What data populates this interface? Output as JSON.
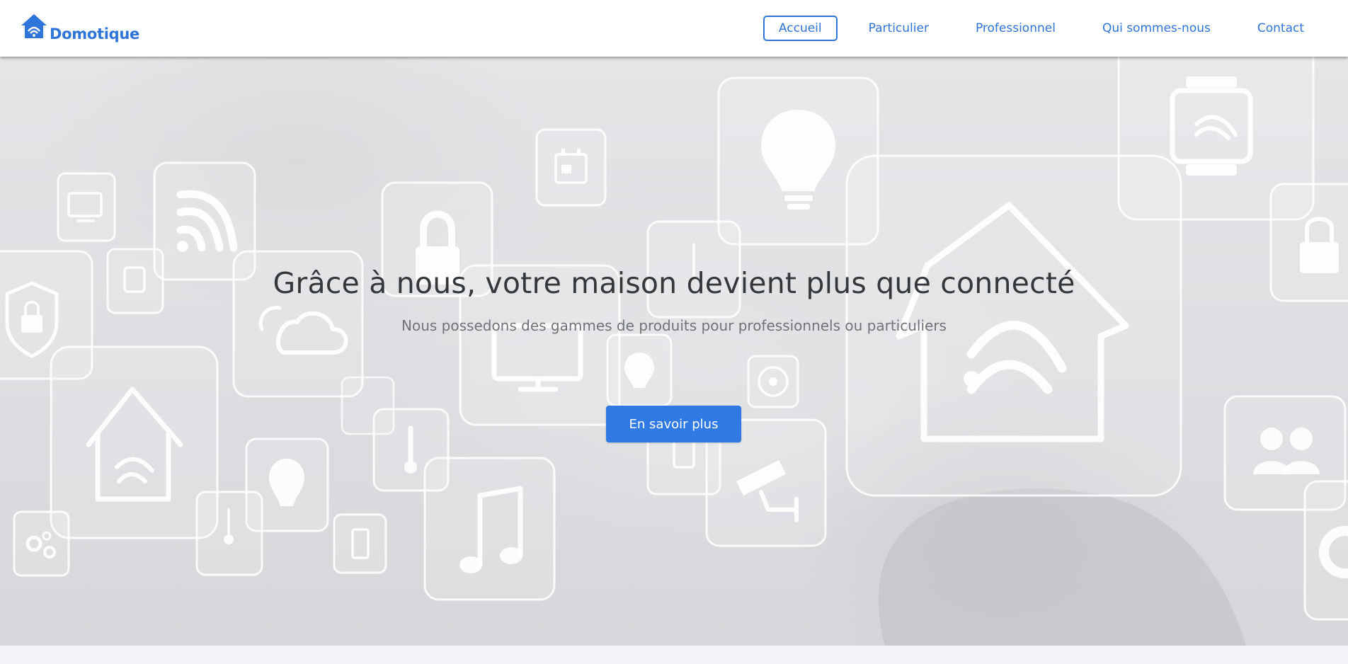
{
  "brand": {
    "name": "Domotique",
    "logo_icon": "house-wifi-icon",
    "accent_color": "#2f74d8"
  },
  "nav": {
    "items": [
      {
        "label": "Accueil",
        "active": true
      },
      {
        "label": "Particulier",
        "active": false
      },
      {
        "label": "Professionnel",
        "active": false
      },
      {
        "label": "Qui sommes-nous",
        "active": false
      },
      {
        "label": "Contact",
        "active": false
      }
    ]
  },
  "hero": {
    "title": "Grâce à nous, votre maison devient plus que connecté",
    "subtitle": "Nous possedons des gammes de produits pour professionnels ou particuliers",
    "cta_label": "En savoir plus",
    "cta_color": "#2f7be3",
    "background_icons": [
      "tv-icon",
      "wifi-icon",
      "lock-icon",
      "calendar-icon",
      "lightbulb-icon",
      "smartwatch-icon",
      "house-wifi-icon",
      "shield-lock-icon",
      "weather-icon",
      "thermometer-icon",
      "monitor-icon",
      "fan-icon",
      "phone-icon",
      "security-camera-icon",
      "music-note-icon",
      "gears-icon",
      "users-icon"
    ]
  }
}
